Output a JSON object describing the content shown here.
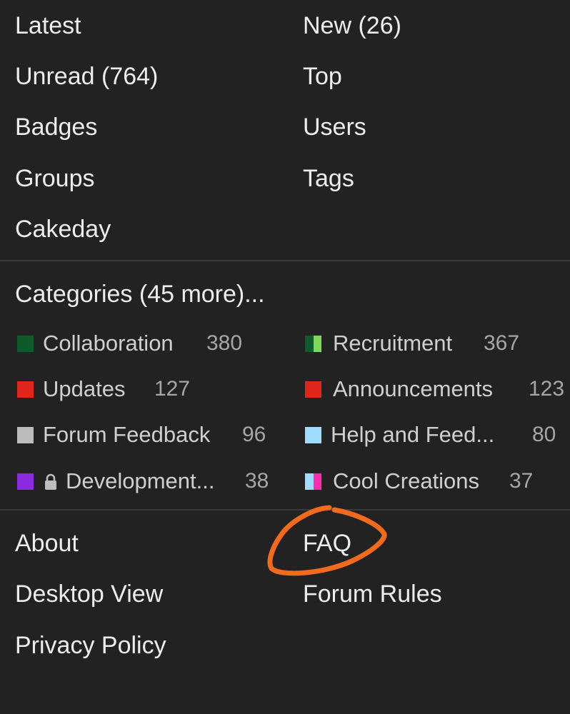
{
  "menu": {
    "left": [
      "Latest",
      "Unread (764)",
      "Badges",
      "Groups",
      "Cakeday"
    ],
    "right": [
      "New (26)",
      "Top",
      "Users",
      "Tags"
    ]
  },
  "categories": {
    "heading": "Categories (45 more)...",
    "items": [
      {
        "name": "Collaboration",
        "count": "380",
        "colors": [
          "#0e5a2a"
        ],
        "locked": false
      },
      {
        "name": "Recruitment",
        "count": "367",
        "colors": [
          "#0e5a2a",
          "#7ed957"
        ],
        "locked": false
      },
      {
        "name": "Updates",
        "count": "127",
        "colors": [
          "#e0251c"
        ],
        "locked": false
      },
      {
        "name": "Announcements",
        "count": "123",
        "colors": [
          "#e0251c"
        ],
        "locked": false
      },
      {
        "name": "Forum Feedback",
        "count": "96",
        "colors": [
          "#bcbcbc"
        ],
        "locked": false
      },
      {
        "name": "Help and Feed...",
        "count": "80",
        "colors": [
          "#9fdcff"
        ],
        "locked": false
      },
      {
        "name": "Development...",
        "count": "38",
        "colors": [
          "#8a2be2"
        ],
        "locked": true
      },
      {
        "name": "Cool Creations",
        "count": "37",
        "colors": [
          "#9fdcff",
          "#ff2bb0"
        ],
        "locked": false
      }
    ]
  },
  "footer": {
    "left": [
      "About",
      "Desktop View",
      "Privacy Policy"
    ],
    "right": [
      "FAQ",
      "Forum Rules"
    ]
  },
  "annotation_color": "#f26a1b"
}
